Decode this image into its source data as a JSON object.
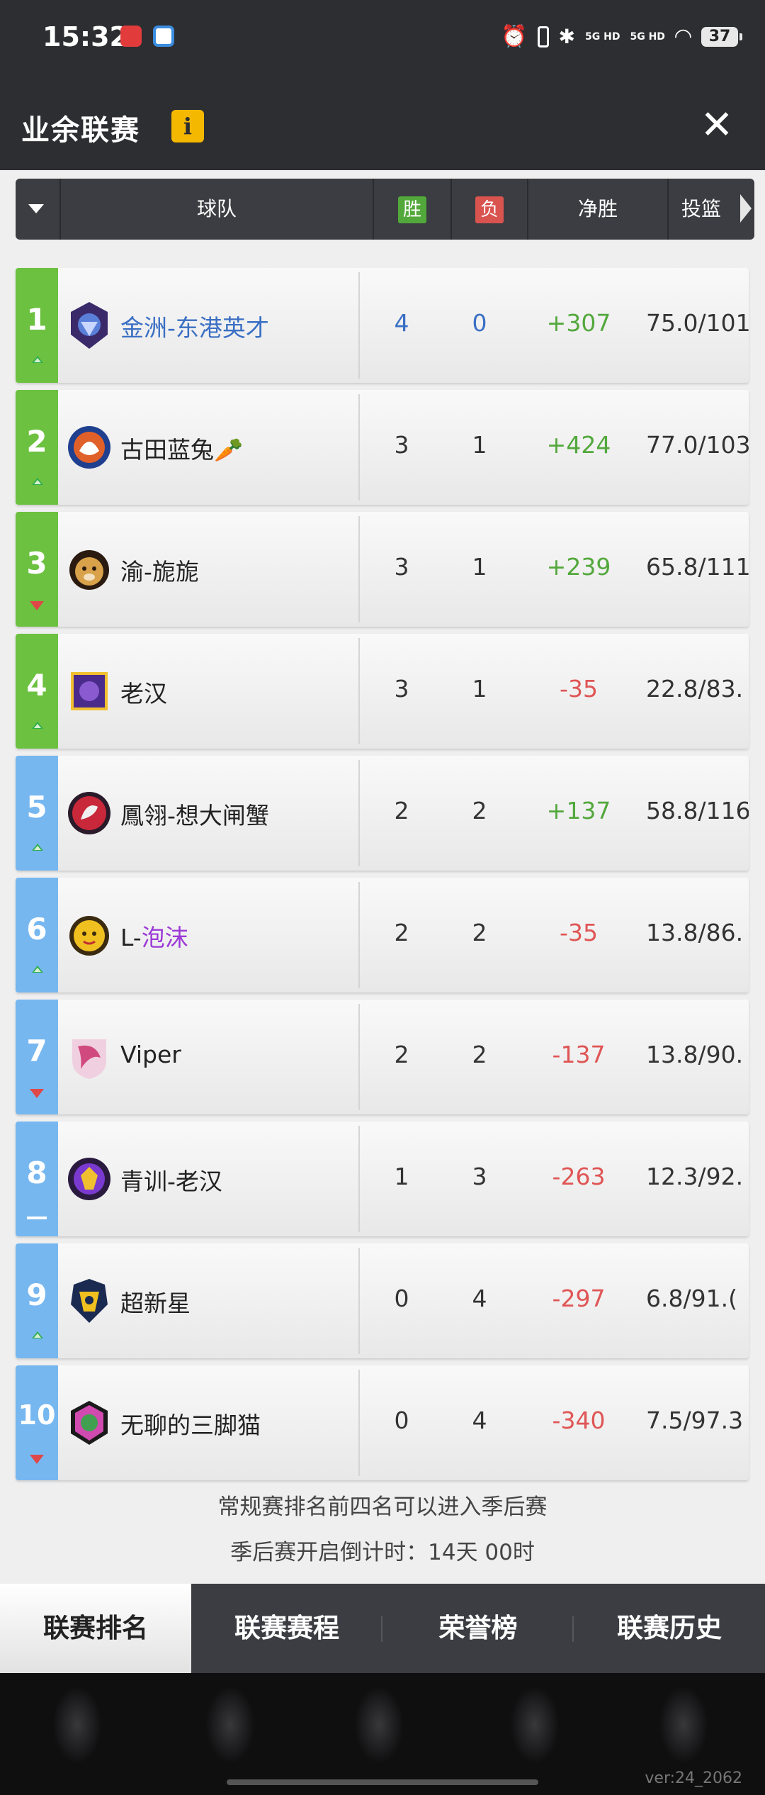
{
  "status_bar": {
    "time": "15:32",
    "network_1": "5G HD",
    "network_2": "5G HD",
    "battery": "37"
  },
  "header": {
    "title": "业余联赛",
    "info_icon": "i",
    "close_icon": "✕"
  },
  "table_header": {
    "team": "球队",
    "wins": "胜",
    "losses": "负",
    "net": "净胜",
    "shooting": "投篮"
  },
  "teams": [
    {
      "rank": "1",
      "name": "金洲-东港英才",
      "wins": "4",
      "losses": "0",
      "net": "+307",
      "shooting": "75.0/101",
      "trend": "up",
      "strip": "green"
    },
    {
      "rank": "2",
      "name": "古田蓝兔🥕",
      "wins": "3",
      "losses": "1",
      "net": "+424",
      "shooting": "77.0/103",
      "trend": "up",
      "strip": "green"
    },
    {
      "rank": "3",
      "name": "渝-旎旎",
      "wins": "3",
      "losses": "1",
      "net": "+239",
      "shooting": "65.8/111",
      "trend": "down",
      "strip": "green"
    },
    {
      "rank": "4",
      "name": "老汉",
      "wins": "3",
      "losses": "1",
      "net": "-35",
      "shooting": "22.8/83.",
      "trend": "up",
      "strip": "green"
    },
    {
      "rank": "5",
      "name": "鳳翎-想大闸蟹",
      "wins": "2",
      "losses": "2",
      "net": "+137",
      "shooting": "58.8/116",
      "trend": "up",
      "strip": "blue"
    },
    {
      "rank": "6",
      "name_prefix": "L-",
      "name_suffix": "泡沫",
      "wins": "2",
      "losses": "2",
      "net": "-35",
      "shooting": "13.8/86.",
      "trend": "up",
      "strip": "blue"
    },
    {
      "rank": "7",
      "name": "Viper",
      "wins": "2",
      "losses": "2",
      "net": "-137",
      "shooting": "13.8/90.",
      "trend": "down",
      "strip": "blue"
    },
    {
      "rank": "8",
      "name": "青训-老汉",
      "wins": "1",
      "losses": "3",
      "net": "-263",
      "shooting": "12.3/92.",
      "trend": "same",
      "strip": "blue"
    },
    {
      "rank": "9",
      "name": "超新星",
      "wins": "0",
      "losses": "4",
      "net": "-297",
      "shooting": "6.8/91.(",
      "trend": "up",
      "strip": "blue"
    },
    {
      "rank": "10",
      "name": "无聊的三脚猫",
      "wins": "0",
      "losses": "4",
      "net": "-340",
      "shooting": "7.5/97.3",
      "trend": "down",
      "strip": "blue"
    }
  ],
  "notes": {
    "playoff_rule": "常规赛排名前四名可以进入季后赛",
    "countdown": "季后赛开启倒计时：14天 00时"
  },
  "tabs": [
    "联赛排名",
    "联赛赛程",
    "荣誉榜",
    "联赛历史"
  ],
  "version": "ver:24_2062",
  "colors": {
    "header_bg": "#2d2e31",
    "playoff_strip": "#6cc140",
    "other_strip": "#76b7f0",
    "positive": "#53a83c",
    "negative": "#e05555",
    "link_blue": "#3a6fc4"
  }
}
